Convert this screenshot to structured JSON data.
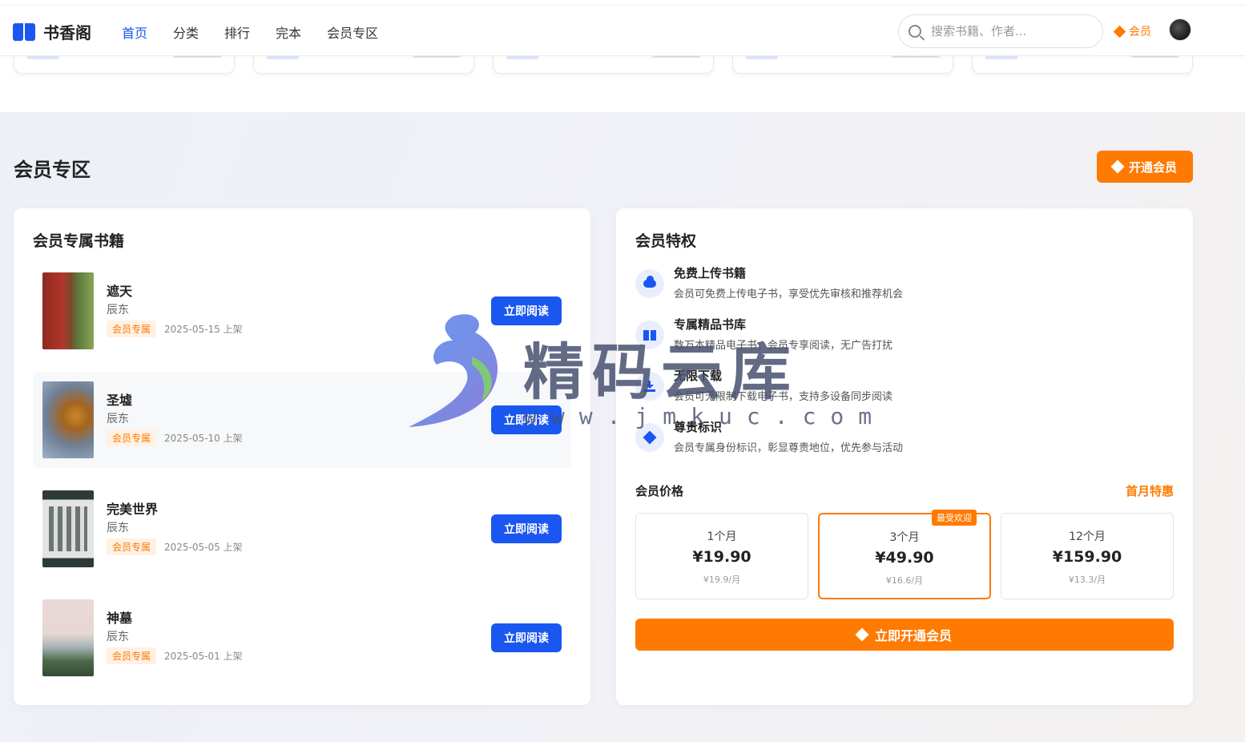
{
  "header": {
    "logo_text": "书香阁",
    "nav": [
      "首页",
      "分类",
      "排行",
      "完本",
      "会员专区"
    ],
    "search_placeholder": "搜索书籍、作者...",
    "vip_label": "会员"
  },
  "section": {
    "title": "会员专区",
    "open_button": "开通会员"
  },
  "books_panel": {
    "title": "会员专属书籍",
    "read_label": "立即阅读",
    "books": [
      {
        "title": "遮天",
        "author": "辰东",
        "badge": "会员专属",
        "date": "2025-05-15 上架"
      },
      {
        "title": "圣墟",
        "author": "辰东",
        "badge": "会员专属",
        "date": "2025-05-10 上架"
      },
      {
        "title": "完美世界",
        "author": "辰东",
        "badge": "会员专属",
        "date": "2025-05-05 上架"
      },
      {
        "title": "神墓",
        "author": "辰东",
        "badge": "会员专属",
        "date": "2025-05-01 上架"
      }
    ]
  },
  "privileges_panel": {
    "title": "会员特权",
    "items": [
      {
        "icon": "cloud-upload-icon",
        "title": "免费上传书籍",
        "desc": "会员可免费上传电子书，享受优先审核和推荐机会"
      },
      {
        "icon": "book-icon",
        "title": "专属精品书库",
        "desc": "数万本精品电子书，会员专享阅读，无广告打扰"
      },
      {
        "icon": "download-icon",
        "title": "无限下载",
        "desc": "会员可无限制下载电子书，支持多设备同步阅读"
      },
      {
        "icon": "gem-icon",
        "title": "尊贵标识",
        "desc": "会员专属身份标识，彰显尊贵地位，优先参与活动"
      }
    ],
    "price_label": "会员价格",
    "price_promo": "首月特惠",
    "plans": [
      {
        "name": "1个月",
        "price": "¥19.90",
        "per": "¥19.9/月",
        "badge": ""
      },
      {
        "name": "3个月",
        "price": "¥49.90",
        "per": "¥16.6/月",
        "badge": "最受欢迎"
      },
      {
        "name": "12个月",
        "price": "¥159.90",
        "per": "¥13.3/月",
        "badge": ""
      }
    ],
    "buy_button": "立即开通会员"
  },
  "watermark": {
    "text": "精码云库",
    "url": "www.jmkuc.com"
  },
  "colors": {
    "primary": "#1a56f0",
    "accent": "#ff7a00"
  }
}
